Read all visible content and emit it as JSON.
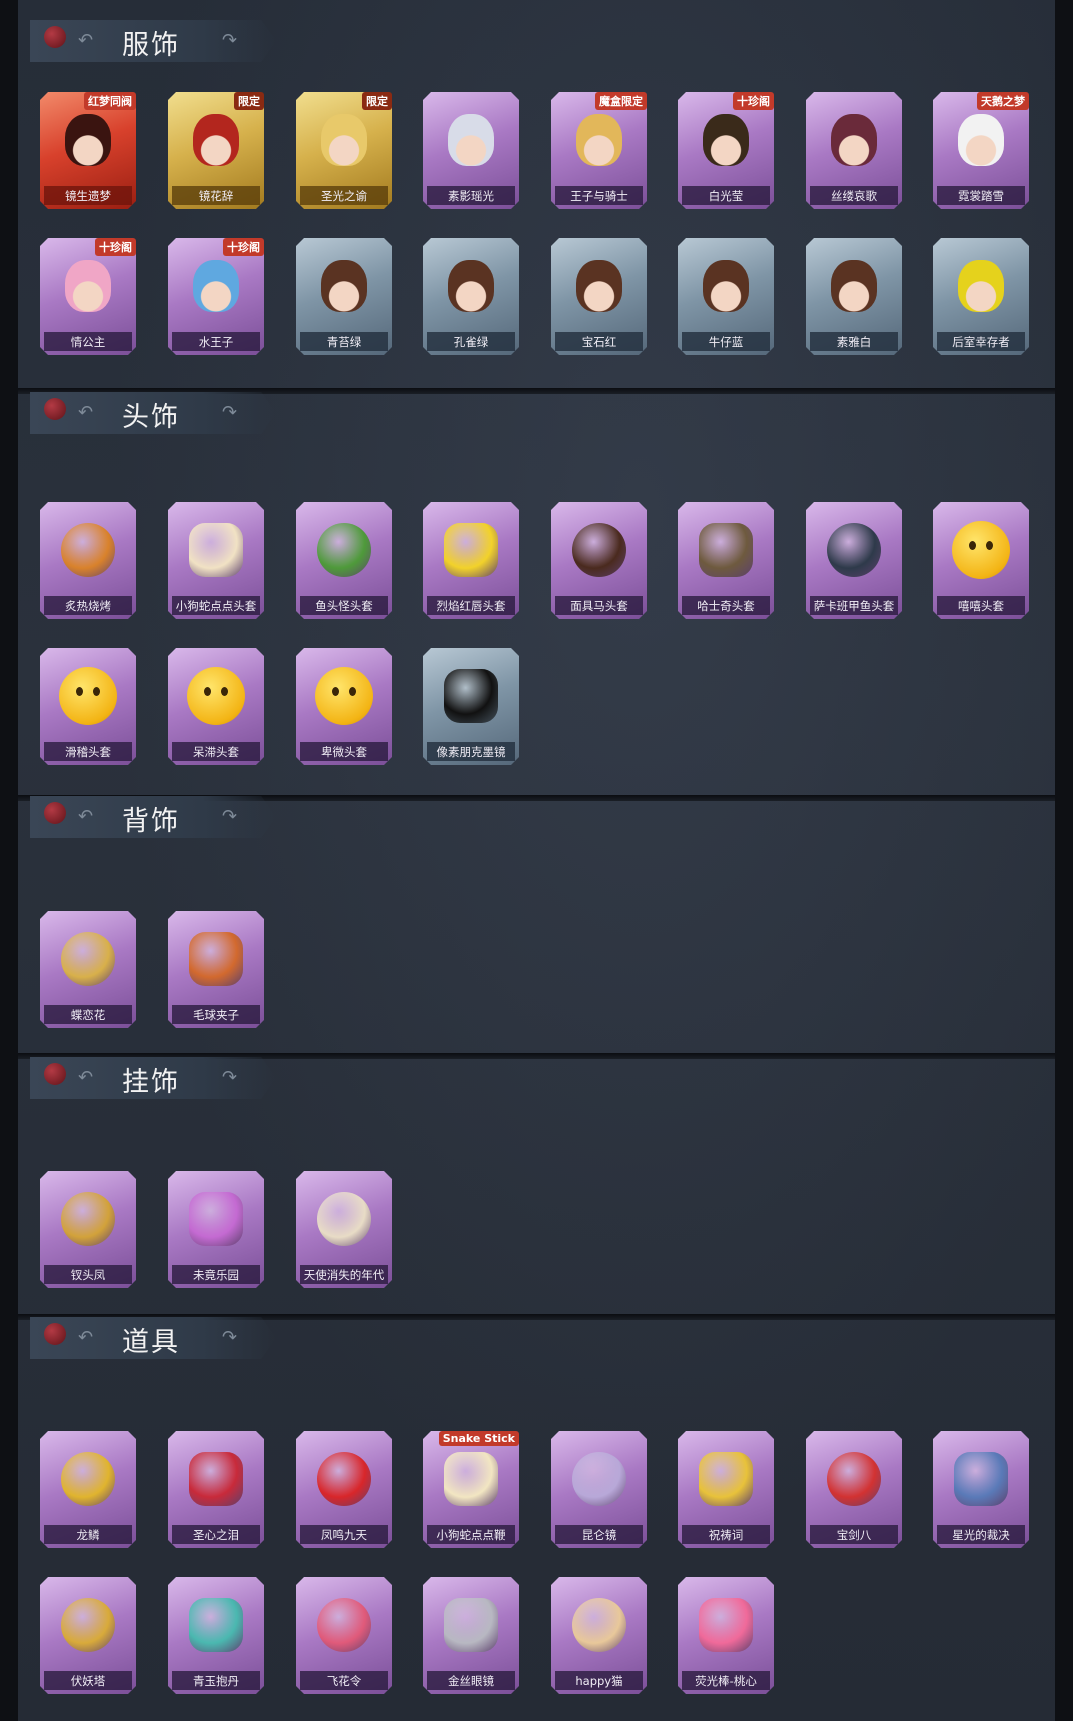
{
  "sections": [
    {
      "key": "costume",
      "title": "服饰",
      "items": [
        {
          "label": "镜生遗梦",
          "frame": "red",
          "badge": "红梦同阀",
          "art": "head",
          "color": "#3a1410"
        },
        {
          "label": "镜花辞",
          "frame": "gold",
          "badge": "限定",
          "art": "head",
          "color": "#b3261e"
        },
        {
          "label": "圣光之谕",
          "frame": "gold",
          "badge": "限定",
          "art": "head",
          "color": "#e8c96a"
        },
        {
          "label": "素影瑶光",
          "frame": "purple",
          "badge": "",
          "art": "head",
          "color": "#d8dce8"
        },
        {
          "label": "王子与骑士",
          "frame": "purple",
          "badge": "魔盒限定",
          "art": "head",
          "color": "#e2b75a"
        },
        {
          "label": "白光莹",
          "frame": "purple",
          "badge": "十珍阁",
          "art": "head",
          "color": "#3a2a1a"
        },
        {
          "label": "丝缕哀歌",
          "frame": "purple",
          "badge": "",
          "art": "head",
          "color": "#6a2a3a"
        },
        {
          "label": "霓裳踏雪",
          "frame": "purple",
          "badge": "天鹅之梦",
          "art": "head",
          "color": "#f2f2f2"
        },
        {
          "label": "情公主",
          "frame": "purple",
          "badge": "十珍阁",
          "art": "head",
          "color": "#f0a6c6"
        },
        {
          "label": "水王子",
          "frame": "purple",
          "badge": "十珍阁",
          "art": "head",
          "color": "#5fa8e0"
        },
        {
          "label": "青苔绿",
          "frame": "blue",
          "badge": "",
          "art": "head",
          "color": "#5a3322"
        },
        {
          "label": "孔雀绿",
          "frame": "blue",
          "badge": "",
          "art": "head",
          "color": "#5a3322"
        },
        {
          "label": "宝石红",
          "frame": "blue",
          "badge": "",
          "art": "head",
          "color": "#5a3322"
        },
        {
          "label": "牛仔蓝",
          "frame": "blue",
          "badge": "",
          "art": "head",
          "color": "#5a3322"
        },
        {
          "label": "素雅白",
          "frame": "blue",
          "badge": "",
          "art": "head",
          "color": "#5a3322"
        },
        {
          "label": "后室幸存者",
          "frame": "blue",
          "badge": "",
          "art": "head",
          "color": "#e5d21c"
        }
      ]
    },
    {
      "key": "headwear",
      "title": "头饰",
      "items": [
        {
          "label": "炙热烧烤",
          "frame": "purple",
          "badge": "",
          "art": "shape",
          "color": "#d9822b"
        },
        {
          "label": "小狗蛇点点头套",
          "frame": "purple",
          "badge": "",
          "art": "shape",
          "color": "#f1e2c4"
        },
        {
          "label": "鱼头怪头套",
          "frame": "purple",
          "badge": "",
          "art": "shape",
          "color": "#4e9a3a"
        },
        {
          "label": "烈焰红唇头套",
          "frame": "purple",
          "badge": "",
          "art": "shape",
          "color": "#f2d22a"
        },
        {
          "label": "面具马头套",
          "frame": "purple",
          "badge": "",
          "art": "shape",
          "color": "#4a2a1e"
        },
        {
          "label": "哈士奇头套",
          "frame": "purple",
          "badge": "",
          "art": "shape",
          "color": "#6e5a3e"
        },
        {
          "label": "萨卡班甲鱼头套",
          "frame": "purple",
          "badge": "",
          "art": "shape",
          "color": "#2e3a4a"
        },
        {
          "label": "嘻嘻头套",
          "frame": "purple",
          "badge": "",
          "art": "emoji",
          "color": "#f3b414"
        },
        {
          "label": "滑稽头套",
          "frame": "purple",
          "badge": "",
          "art": "emoji",
          "color": "#f3b414"
        },
        {
          "label": "呆滞头套",
          "frame": "purple",
          "badge": "",
          "art": "emoji",
          "color": "#f3b414"
        },
        {
          "label": "卑微头套",
          "frame": "purple",
          "badge": "",
          "art": "emoji",
          "color": "#f3b414"
        },
        {
          "label": "像素朋克墨镜",
          "frame": "blue",
          "badge": "",
          "art": "shape",
          "color": "#111111"
        }
      ]
    },
    {
      "key": "backwear",
      "title": "背饰",
      "items": [
        {
          "label": "蝶恋花",
          "frame": "purple",
          "badge": "",
          "art": "shape",
          "color": "#d8b04a"
        },
        {
          "label": "毛球夹子",
          "frame": "purple",
          "badge": "",
          "art": "shape",
          "color": "#d2692e"
        }
      ]
    },
    {
      "key": "pendant",
      "title": "挂饰",
      "items": [
        {
          "label": "钗头凤",
          "frame": "purple",
          "badge": "",
          "art": "shape",
          "color": "#d2a23a"
        },
        {
          "label": "未竟乐园",
          "frame": "purple",
          "badge": "",
          "art": "shape",
          "color": "#c46ad2"
        },
        {
          "label": "天使消失的年代",
          "frame": "purple",
          "badge": "",
          "art": "shape",
          "color": "#e8dcc6"
        }
      ]
    },
    {
      "key": "props",
      "title": "道具",
      "items": [
        {
          "label": "龙鳞",
          "frame": "purple",
          "badge": "",
          "art": "shape",
          "color": "#e0b42e"
        },
        {
          "label": "圣心之泪",
          "frame": "purple",
          "badge": "",
          "art": "shape",
          "color": "#c82a3a"
        },
        {
          "label": "凤鸣九天",
          "frame": "purple",
          "badge": "",
          "art": "shape",
          "color": "#d8262a"
        },
        {
          "label": "小狗蛇点点鞭",
          "frame": "purple",
          "badge": "Snake Stick",
          "art": "shape",
          "color": "#f2e6c2"
        },
        {
          "label": "昆仑镜",
          "frame": "purple",
          "badge": "",
          "art": "shape",
          "color": "#b8a8d8"
        },
        {
          "label": "祝祷词",
          "frame": "purple",
          "badge": "",
          "art": "shape",
          "color": "#e8c23a"
        },
        {
          "label": "宝剑八",
          "frame": "purple",
          "badge": "",
          "art": "shape",
          "color": "#d23232"
        },
        {
          "label": "星光的裁决",
          "frame": "purple",
          "badge": "",
          "art": "shape",
          "color": "#5a7ab8"
        },
        {
          "label": "伏妖塔",
          "frame": "purple",
          "badge": "",
          "art": "shape",
          "color": "#d8aa3a"
        },
        {
          "label": "青玉抱丹",
          "frame": "purple",
          "badge": "",
          "art": "shape",
          "color": "#4ab8b0"
        },
        {
          "label": "飞花令",
          "frame": "purple",
          "badge": "",
          "art": "shape",
          "color": "#e05a7a"
        },
        {
          "label": "金丝眼镜",
          "frame": "purple",
          "badge": "",
          "art": "shape",
          "color": "#b8b8c2"
        },
        {
          "label": "happy猫",
          "frame": "purple",
          "badge": "",
          "art": "shape",
          "color": "#e8c89a"
        },
        {
          "label": "荧光棒-桃心",
          "frame": "purple",
          "badge": "",
          "art": "shape",
          "color": "#f06a9a"
        }
      ]
    }
  ]
}
